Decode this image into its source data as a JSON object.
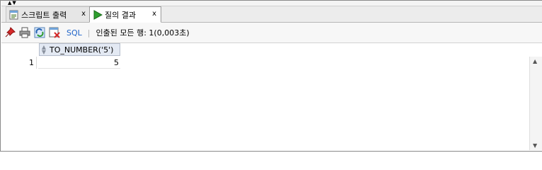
{
  "tabs": [
    {
      "label": "스크립트 출력",
      "close": "x"
    },
    {
      "label": "질의 결과",
      "close": "x"
    }
  ],
  "toolbar": {
    "icons": [
      "pin-icon",
      "print-icon",
      "refresh-icon",
      "export-icon"
    ],
    "sql_label": "SQL",
    "separator": "|",
    "status": "인출된 모든 행: 1(0,003초)"
  },
  "grid": {
    "columns": [
      "TO_NUMBER('5')"
    ],
    "rows": [
      {
        "num": "1",
        "values": [
          "5"
        ]
      }
    ]
  },
  "colors": {
    "accent": "#1e63c9",
    "header_bg": "#e3e9f3",
    "run_green": "#2e9f2e"
  }
}
